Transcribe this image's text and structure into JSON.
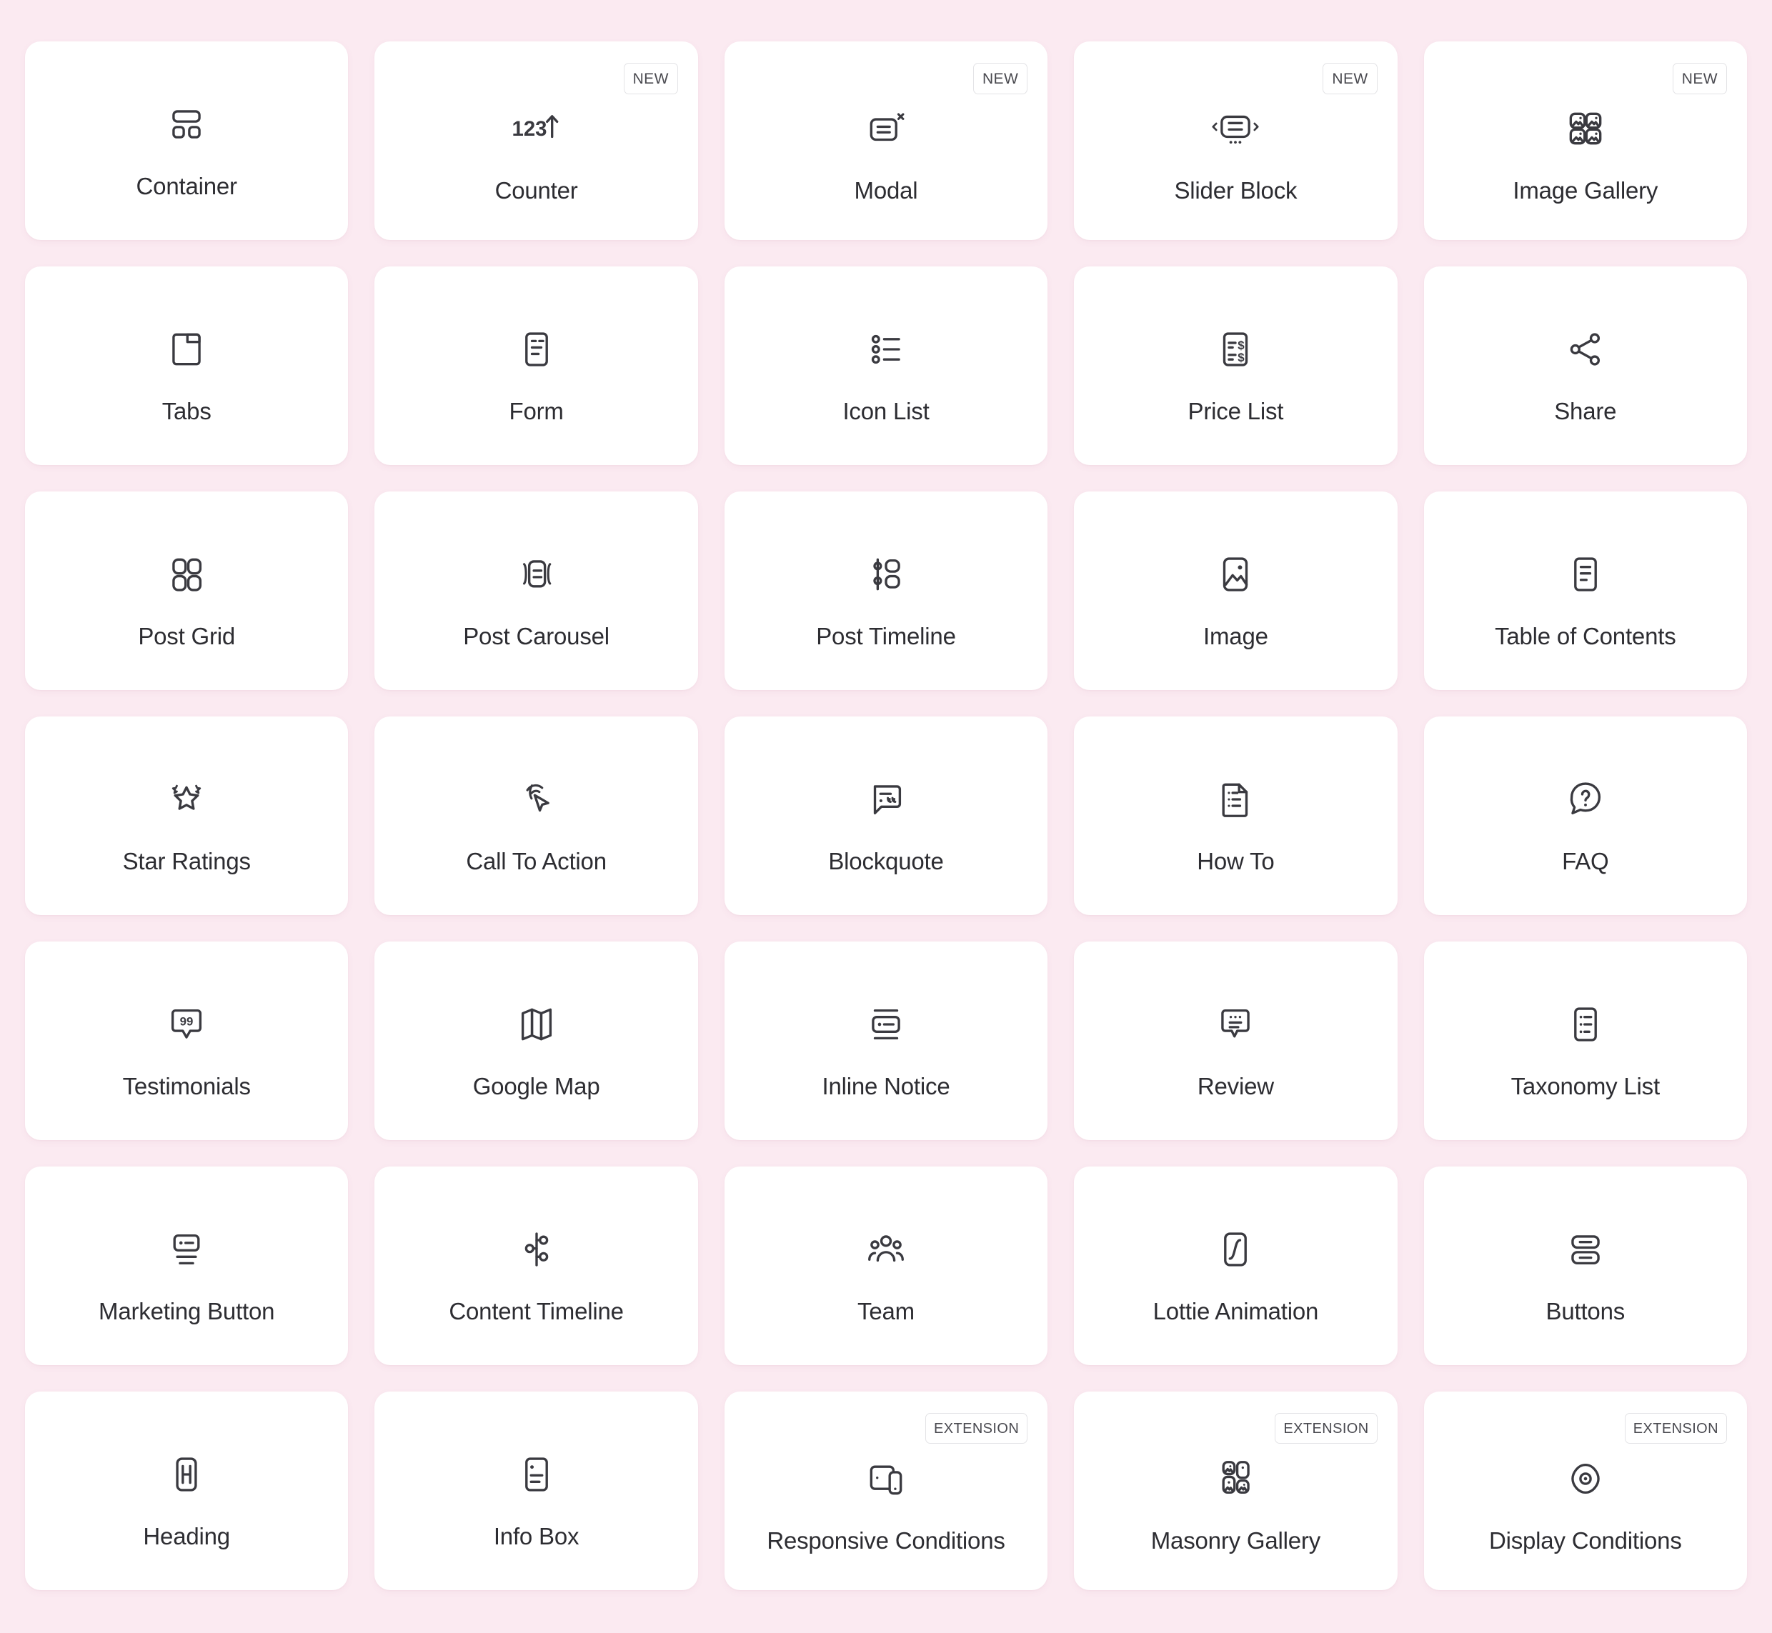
{
  "theme": {
    "background": "#fbeaf1",
    "card_background": "#ffffff",
    "icon_color": "#3a3a40",
    "label_color": "#2d2d32",
    "badge_border": "#e3e3e6"
  },
  "badges": {
    "new": "NEW",
    "extension": "EXTENSION"
  },
  "grid": {
    "columns": 5,
    "rows": 7,
    "count": 35
  },
  "widgets": [
    {
      "label": "Container",
      "icon": "container-icon",
      "badge": ""
    },
    {
      "label": "Counter",
      "icon": "counter-icon",
      "badge": "NEW"
    },
    {
      "label": "Modal",
      "icon": "modal-icon",
      "badge": "NEW"
    },
    {
      "label": "Slider Block",
      "icon": "slider-block-icon",
      "badge": "NEW"
    },
    {
      "label": "Image Gallery",
      "icon": "image-gallery-icon",
      "badge": "NEW"
    },
    {
      "label": "Tabs",
      "icon": "tabs-icon",
      "badge": ""
    },
    {
      "label": "Form",
      "icon": "form-icon",
      "badge": ""
    },
    {
      "label": "Icon List",
      "icon": "icon-list-icon",
      "badge": ""
    },
    {
      "label": "Price List",
      "icon": "price-list-icon",
      "badge": ""
    },
    {
      "label": "Share",
      "icon": "share-icon",
      "badge": ""
    },
    {
      "label": "Post Grid",
      "icon": "post-grid-icon",
      "badge": ""
    },
    {
      "label": "Post Carousel",
      "icon": "post-carousel-icon",
      "badge": ""
    },
    {
      "label": "Post Timeline",
      "icon": "post-timeline-icon",
      "badge": ""
    },
    {
      "label": "Image",
      "icon": "image-icon",
      "badge": ""
    },
    {
      "label": "Table of Contents",
      "icon": "table-of-contents-icon",
      "badge": ""
    },
    {
      "label": "Star Ratings",
      "icon": "star-ratings-icon",
      "badge": ""
    },
    {
      "label": "Call To Action",
      "icon": "call-to-action-icon",
      "badge": ""
    },
    {
      "label": "Blockquote",
      "icon": "blockquote-icon",
      "badge": ""
    },
    {
      "label": "How To",
      "icon": "how-to-icon",
      "badge": ""
    },
    {
      "label": "FAQ",
      "icon": "faq-icon",
      "badge": ""
    },
    {
      "label": "Testimonials",
      "icon": "testimonials-icon",
      "badge": ""
    },
    {
      "label": "Google Map",
      "icon": "google-map-icon",
      "badge": ""
    },
    {
      "label": "Inline Notice",
      "icon": "inline-notice-icon",
      "badge": ""
    },
    {
      "label": "Review",
      "icon": "review-icon",
      "badge": ""
    },
    {
      "label": "Taxonomy List",
      "icon": "taxonomy-list-icon",
      "badge": ""
    },
    {
      "label": "Marketing Button",
      "icon": "marketing-button-icon",
      "badge": ""
    },
    {
      "label": "Content Timeline",
      "icon": "content-timeline-icon",
      "badge": ""
    },
    {
      "label": "Team",
      "icon": "team-icon",
      "badge": ""
    },
    {
      "label": "Lottie Animation",
      "icon": "lottie-animation-icon",
      "badge": ""
    },
    {
      "label": "Buttons",
      "icon": "buttons-icon",
      "badge": ""
    },
    {
      "label": "Heading",
      "icon": "heading-icon",
      "badge": ""
    },
    {
      "label": "Info Box",
      "icon": "info-box-icon",
      "badge": ""
    },
    {
      "label": "Responsive Conditions",
      "icon": "responsive-conditions-icon",
      "badge": "EXTENSION"
    },
    {
      "label": "Masonry Gallery",
      "icon": "masonry-gallery-icon",
      "badge": "EXTENSION"
    },
    {
      "label": "Display Conditions",
      "icon": "display-conditions-icon",
      "badge": "EXTENSION"
    }
  ]
}
